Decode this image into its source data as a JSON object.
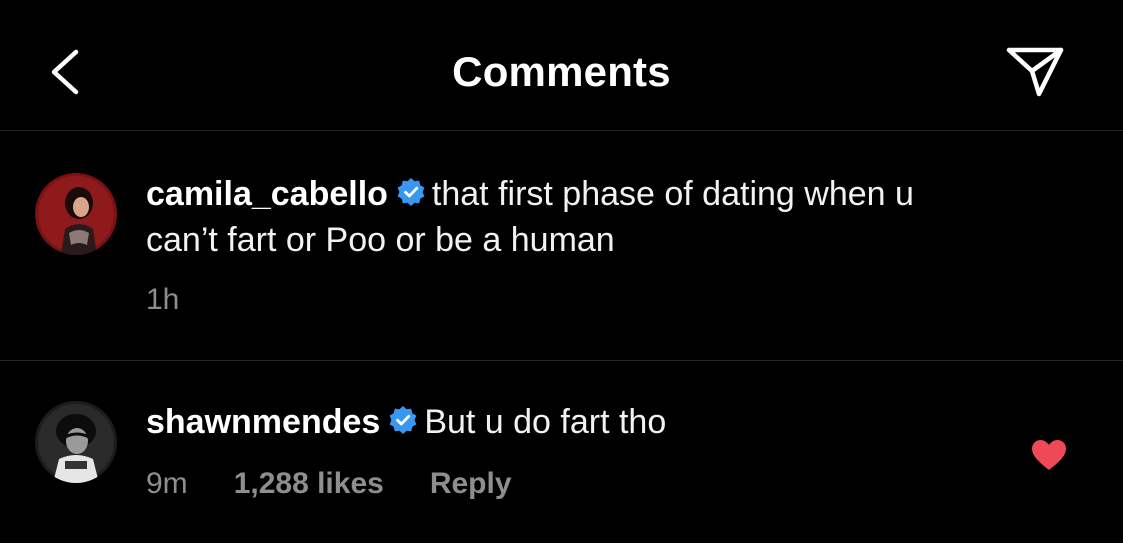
{
  "header": {
    "title": "Comments",
    "back_icon": "chevron-left-icon",
    "send_icon": "paper-plane-icon"
  },
  "caption": {
    "username": "camila_cabello",
    "verified": true,
    "text_line1": "that first phase of dating when u",
    "text_line2": "can’t fart or Poo or be a human",
    "time": "1h"
  },
  "comment": {
    "username": "shawnmendes",
    "verified": true,
    "text": "But u do fart tho",
    "time": "9m",
    "likes": "1,288 likes",
    "reply_label": "Reply",
    "liked": true
  },
  "colors": {
    "background": "#000000",
    "divider": "#262626",
    "text": "#ffffff",
    "muted": "#8e8e8e",
    "verified": "#3897f0",
    "heart": "#ed4956"
  }
}
